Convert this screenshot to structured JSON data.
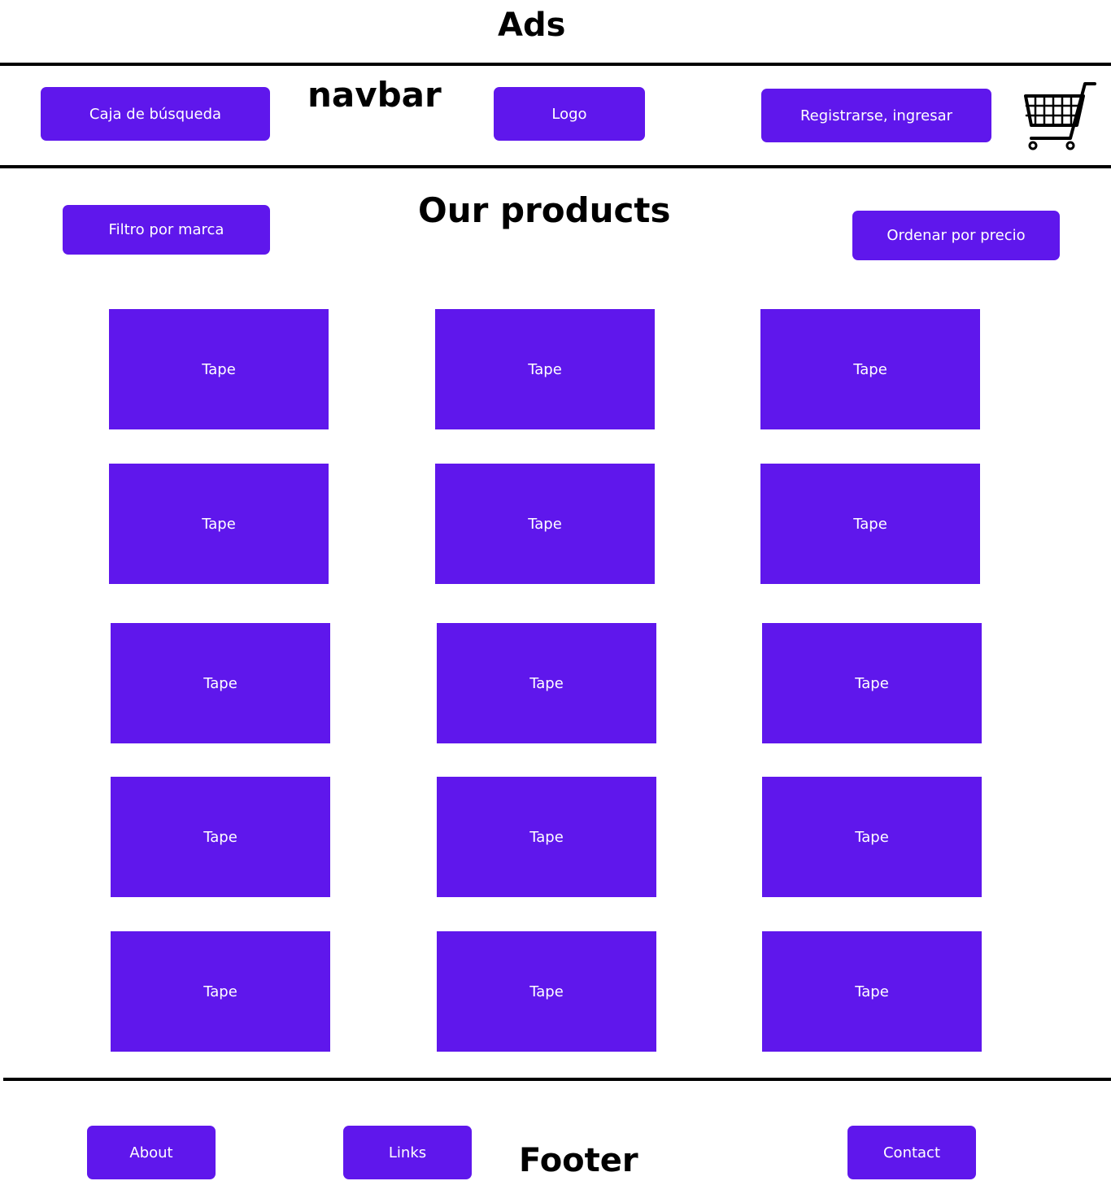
{
  "ads": {
    "label": "Ads"
  },
  "navbar": {
    "label": "navbar",
    "search_button": "Caja de búsqueda",
    "logo_button": "Logo",
    "auth_button": "Registrarse, ingresar",
    "cart_icon": "shopping-cart-icon"
  },
  "products": {
    "title": "Our products",
    "filter_button": "Filtro por marca",
    "sort_button": "Ordenar por precio",
    "rows": [
      [
        "Tape",
        "Tape",
        "Tape"
      ],
      [
        "Tape",
        "Tape",
        "Tape"
      ],
      [
        "Tape",
        "Tape",
        "Tape"
      ],
      [
        "Tape",
        "Tape",
        "Tape"
      ],
      [
        "Tape",
        "Tape",
        "Tape"
      ]
    ]
  },
  "footer": {
    "label": "Footer",
    "about_button": "About",
    "links_button": "Links",
    "contact_button": "Contact"
  },
  "colors": {
    "accent": "#5f17ec",
    "text_on_accent": "#ffffff",
    "divider": "#000000",
    "background": "#ffffff"
  }
}
